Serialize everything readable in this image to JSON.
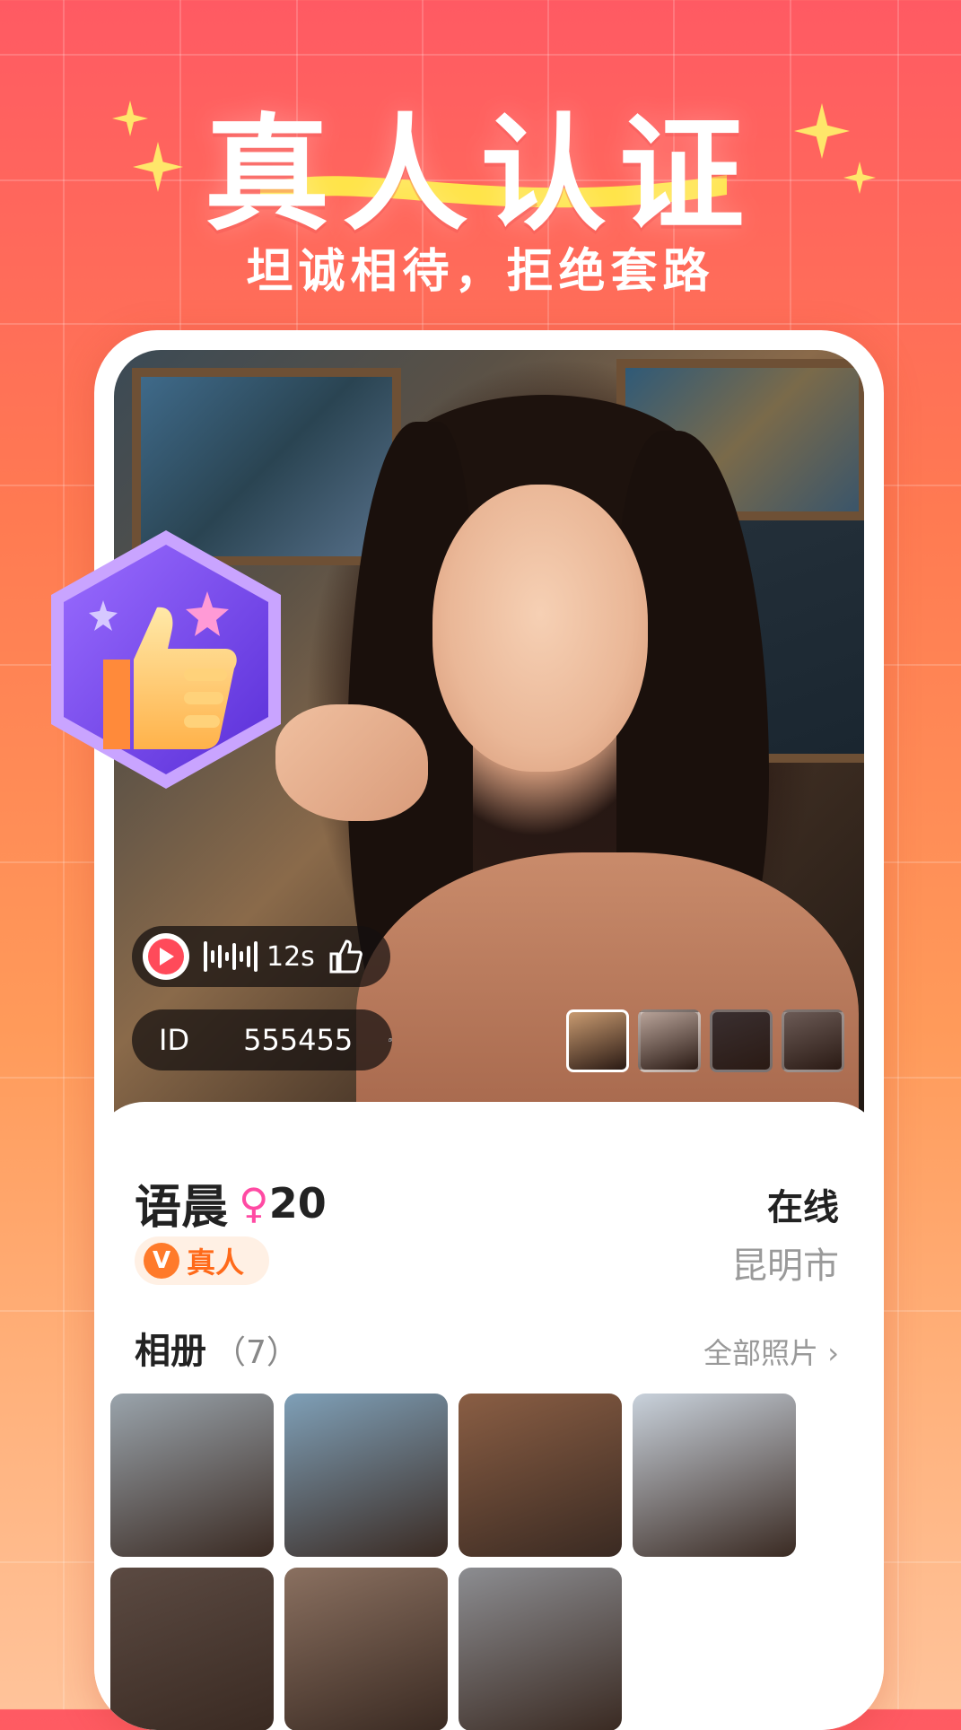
{
  "header": {
    "headline": "真人认证",
    "subtitle": "坦诚相待，拒绝套路"
  },
  "profile": {
    "audio_duration": "12s",
    "id_label": "ID",
    "id_value": "555455",
    "name": "语晨",
    "sex_symbol": "♀",
    "age": "20",
    "status": "在线",
    "city": "昆明市",
    "verified_badge_letter": "V",
    "verified_label": "真人"
  },
  "album": {
    "title": "相册",
    "count": "（7）",
    "view_all": "全部照片"
  },
  "thumbnails": [
    {
      "name": "thumbnail-1",
      "color": "#c89a70"
    },
    {
      "name": "thumbnail-2",
      "color": "#b7a298"
    },
    {
      "name": "thumbnail-3",
      "color": "#3a2f30"
    },
    {
      "name": "thumbnail-4",
      "color": "#6b5a55"
    }
  ],
  "gallery": [
    {
      "name": "album-photo-1",
      "color": "#9aa4ac"
    },
    {
      "name": "album-photo-2",
      "color": "#7fa0b8"
    },
    {
      "name": "album-photo-3",
      "color": "#8a5e44"
    },
    {
      "name": "album-photo-4",
      "color": "#c9d2dc"
    },
    {
      "name": "album-photo-5",
      "color": "#5b4a42"
    },
    {
      "name": "album-photo-6",
      "color": "#8a7060"
    },
    {
      "name": "album-photo-7",
      "color": "#8c8d91"
    }
  ],
  "colors": {
    "accent": "#ff4a5a",
    "verified": "#ff7a2a",
    "female": "#ff4aa3"
  }
}
